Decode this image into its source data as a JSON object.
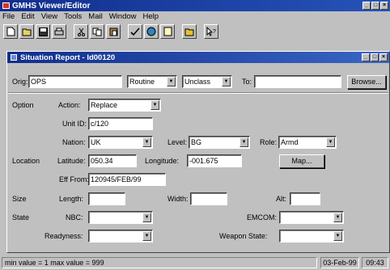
{
  "app": {
    "title": "GMHS Viewer/Editor"
  },
  "menu": [
    "File",
    "Edit",
    "View",
    "Tools",
    "Mail",
    "Window",
    "Help"
  ],
  "toolbar": {
    "icons": [
      "new-icon",
      "open-icon",
      "save-icon",
      "print-icon",
      "cut-icon",
      "copy-icon",
      "paste-icon",
      "check-icon",
      "globe-icon",
      "note-icon",
      "folder-icon",
      "help-pointer-icon"
    ]
  },
  "child": {
    "title": "Situation Report - Id00120"
  },
  "header": {
    "orig_label": "Orig:",
    "orig_value": "OPS",
    "priority": "Routine",
    "classification": "Unclass",
    "to_label": "To:",
    "to_value": "",
    "browse_label": "Browse..."
  },
  "form": {
    "option_label": "Option",
    "action_label": "Action:",
    "action_value": "Replace",
    "unitid_label": "Unit ID:",
    "unitid_value": "c/120",
    "nation_label": "Nation:",
    "nation_value": "UK",
    "level_label": "Level:",
    "level_value": "BG",
    "role_label": "Role:",
    "role_value": "Armd",
    "location_label": "Location",
    "latitude_label": "Latitude:",
    "latitude_value": "050.34",
    "longitude_label": "Longitude:",
    "longitude_value": "-001.675",
    "map_label": "Map...",
    "efffrom_label": "Eff From:",
    "efffrom_value": "120945/FEB/99",
    "size_label": "Size",
    "length_label": "Length:",
    "length_value": "",
    "width_label": "Width:",
    "width_value": "",
    "alt_label": "Alt:",
    "alt_value": "",
    "state_label": "State",
    "nbc_label": "NBC:",
    "nbc_value": "",
    "emcom_label": "EMCOM:",
    "emcom_value": "",
    "readyness_label": "Readyness:",
    "readyness_value": "",
    "weaponstate_label": "Weapon State:",
    "weaponstate_value": ""
  },
  "status": {
    "message": "min value = 1 max value = 999",
    "date": "03-Feb-99",
    "time": "09:43"
  }
}
